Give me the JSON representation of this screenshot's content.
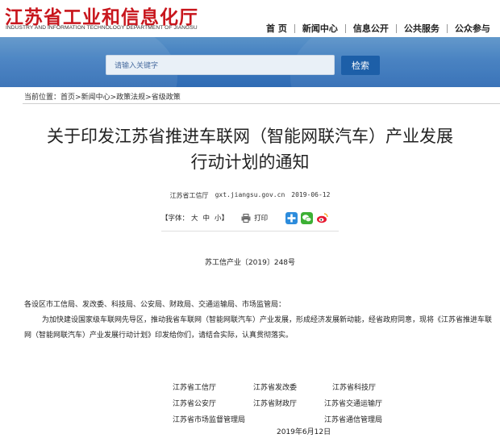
{
  "header": {
    "logo_cn": "江苏省工业和信息化厅",
    "logo_en": "INDUSTRY AND INFORMATION TECHNOLOGY DEPARTMENT OF JIANGSU",
    "nav": [
      "首 页",
      "新闻中心",
      "信息公开",
      "公共服务",
      "公众参与"
    ]
  },
  "search": {
    "placeholder": "请输入关键字",
    "button": "检索"
  },
  "breadcrumb": {
    "prefix": "当前位置：",
    "items": [
      "首页",
      "新闻中心",
      "政策法规",
      "省级政策"
    ],
    "separator": ">"
  },
  "article": {
    "title_line1": "关于印发江苏省推进车联网（智能网联汽车）产业发展",
    "title_line2": "行动计划的通知",
    "source": "江苏省工信厅",
    "site": "gxt.jiangsu.gov.cn",
    "date": "2019-06-12",
    "font_label": "【字体：",
    "font_sizes": [
      "大",
      "中",
      "小"
    ],
    "font_close": "】",
    "print": "打印",
    "share_icons": [
      "plus-share-icon",
      "wechat-icon",
      "weibo-icon"
    ],
    "doc_number": "苏工信产业〔2019〕248号",
    "recipients": "各设区市工信局、发改委、科技局、公安局、财政局、交通运输局、市场监管局：",
    "body": "为加快建设国家级车联网先导区，推动我省车联网（智能网联汽车）产业发展，形成经济发展新动能，经省政府同意，现将《江苏省推进车联网（智能网联汽车）产业发展行动计划》印发给你们，请结合实际，认真贯彻落实。",
    "signatories": [
      [
        "江苏省工信厅",
        "江苏省发改委",
        "江苏省科技厅"
      ],
      [
        "江苏省公安厅",
        "江苏省财政厅",
        "江苏省交通运输厅"
      ],
      [
        "江苏省市场监督管理局",
        "",
        "江苏省通信管理局"
      ]
    ],
    "sign_date": "2019年6月12日"
  },
  "colors": {
    "brand_red": "#c8161d",
    "banner_blue": "#3f7cbf",
    "button_blue": "#1d5fa8"
  }
}
